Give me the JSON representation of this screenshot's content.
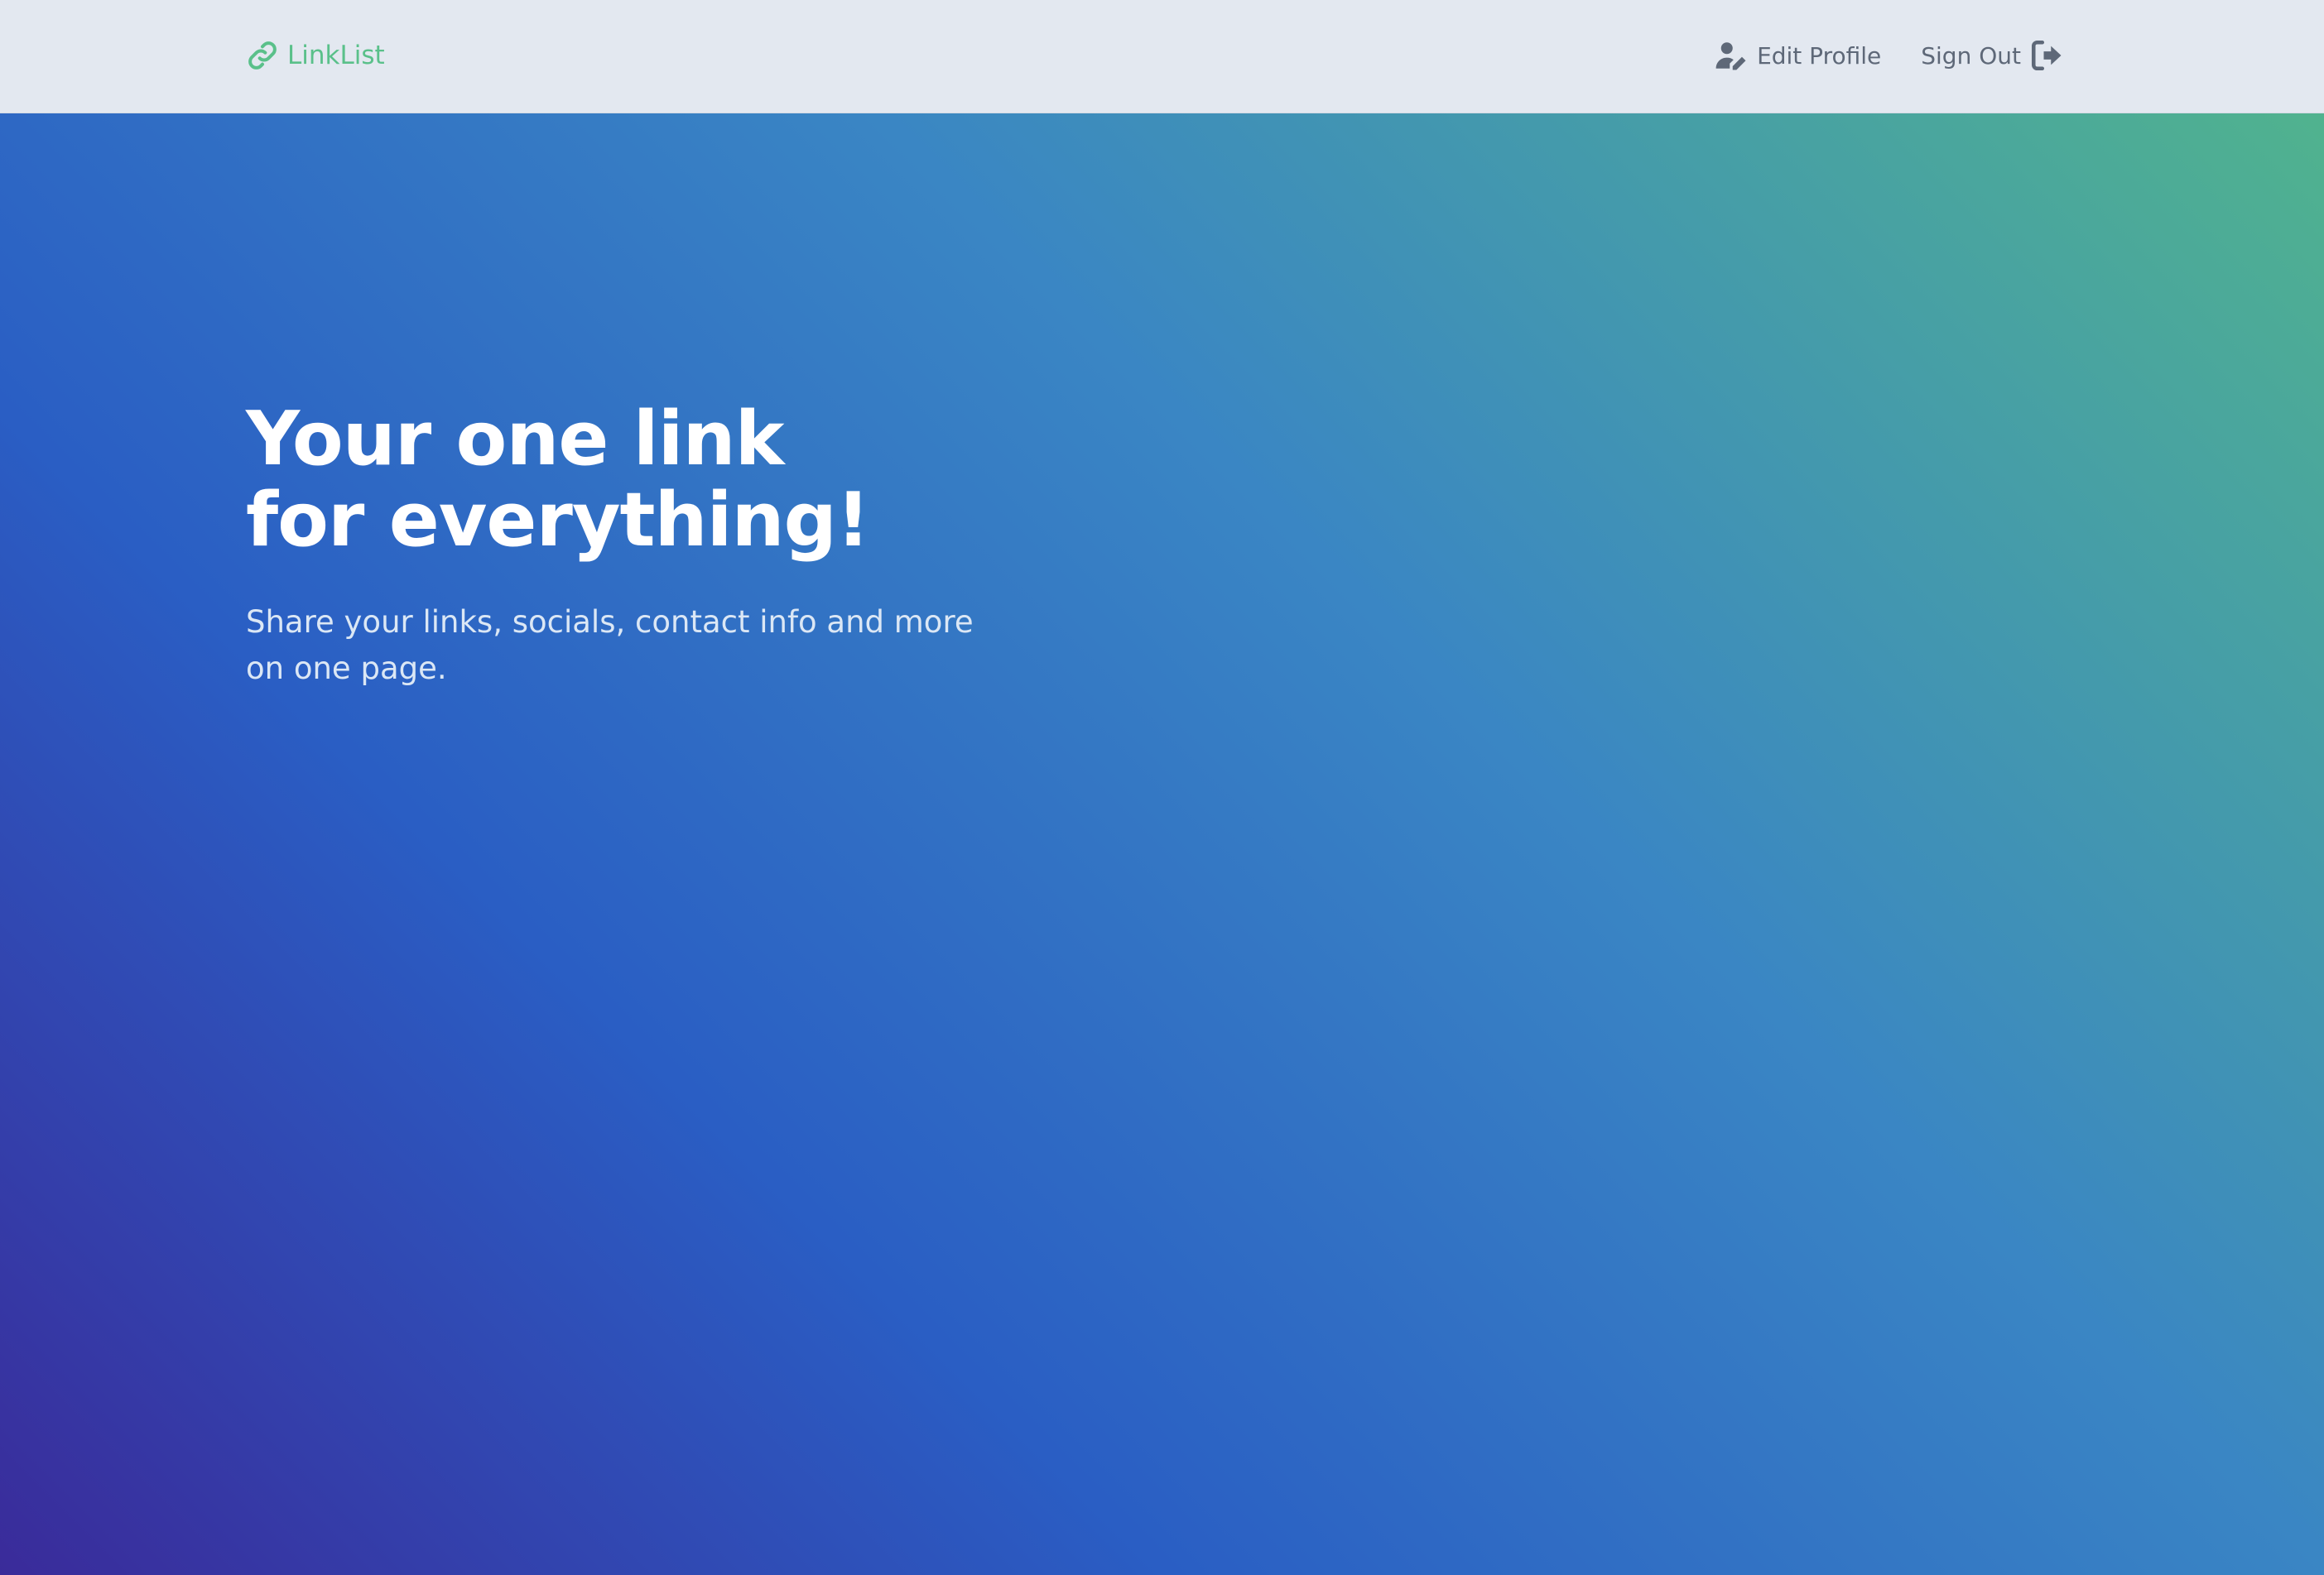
{
  "header": {
    "brand": {
      "label": "LinkList",
      "icon": "link-icon",
      "color": "#5ac08a"
    },
    "nav": [
      {
        "label": "Edit Profile",
        "icon": "user-edit-icon"
      },
      {
        "label": "Sign Out",
        "icon": "sign-out-icon"
      }
    ]
  },
  "hero": {
    "title_line1": "Your one link",
    "title_line2": "for everything!",
    "subtitle": "Share your links, socials, contact info and more on one page."
  },
  "colors": {
    "header_bg": "#e3e8f0",
    "gradient": [
      "#3a2b9a",
      "#2a5ec4",
      "#3a86c4",
      "#52b68a"
    ]
  }
}
